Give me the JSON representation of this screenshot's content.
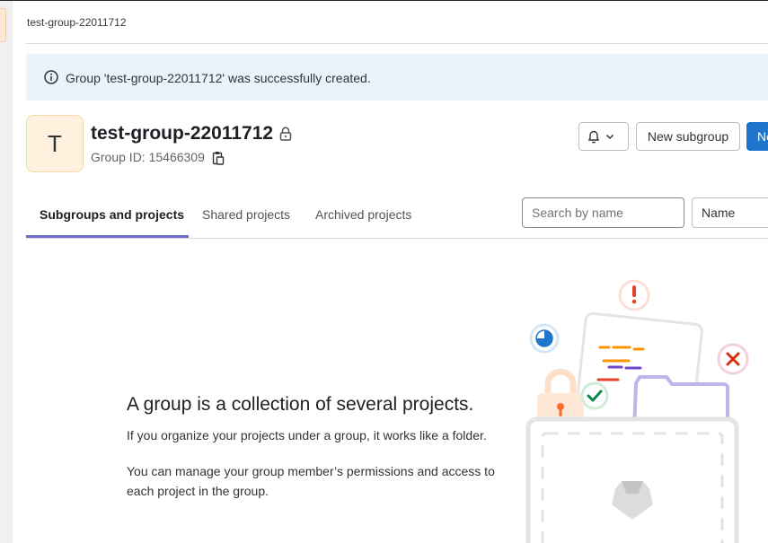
{
  "breadcrumb": {
    "current": "test-group-22011712"
  },
  "alert": {
    "message": "Group 'test-group-22011712' was successfully created."
  },
  "group": {
    "avatar_letter": "T",
    "name": "test-group-22011712",
    "id_text": "Group ID: 15466309"
  },
  "actions": {
    "new_subgroup": "New subgroup",
    "new_project": "Ne"
  },
  "tabs": [
    {
      "label": "Subgroups and projects",
      "active": true
    },
    {
      "label": "Shared projects",
      "active": false
    },
    {
      "label": "Archived projects",
      "active": false
    }
  ],
  "search": {
    "placeholder": "Search by name"
  },
  "sort": {
    "selected": "Name"
  },
  "empty_state": {
    "title": "A group is a collection of several projects.",
    "line1": "If you organize your projects under a group, it works like a folder.",
    "line2": "You can manage your group member’s permissions and access to each project in the group."
  },
  "icons": {
    "alert": "info-icon",
    "visibility": "lock-icon",
    "copy": "copy-to-clipboard-icon",
    "notifications": "bell-icon",
    "dropdown": "chevron-down-icon"
  },
  "colors": {
    "primary": "#1f75cb",
    "alert_bg": "#e9f3fc",
    "tab_underline": "#6e6cc4",
    "avatar_bg": "#fdf1dd"
  }
}
